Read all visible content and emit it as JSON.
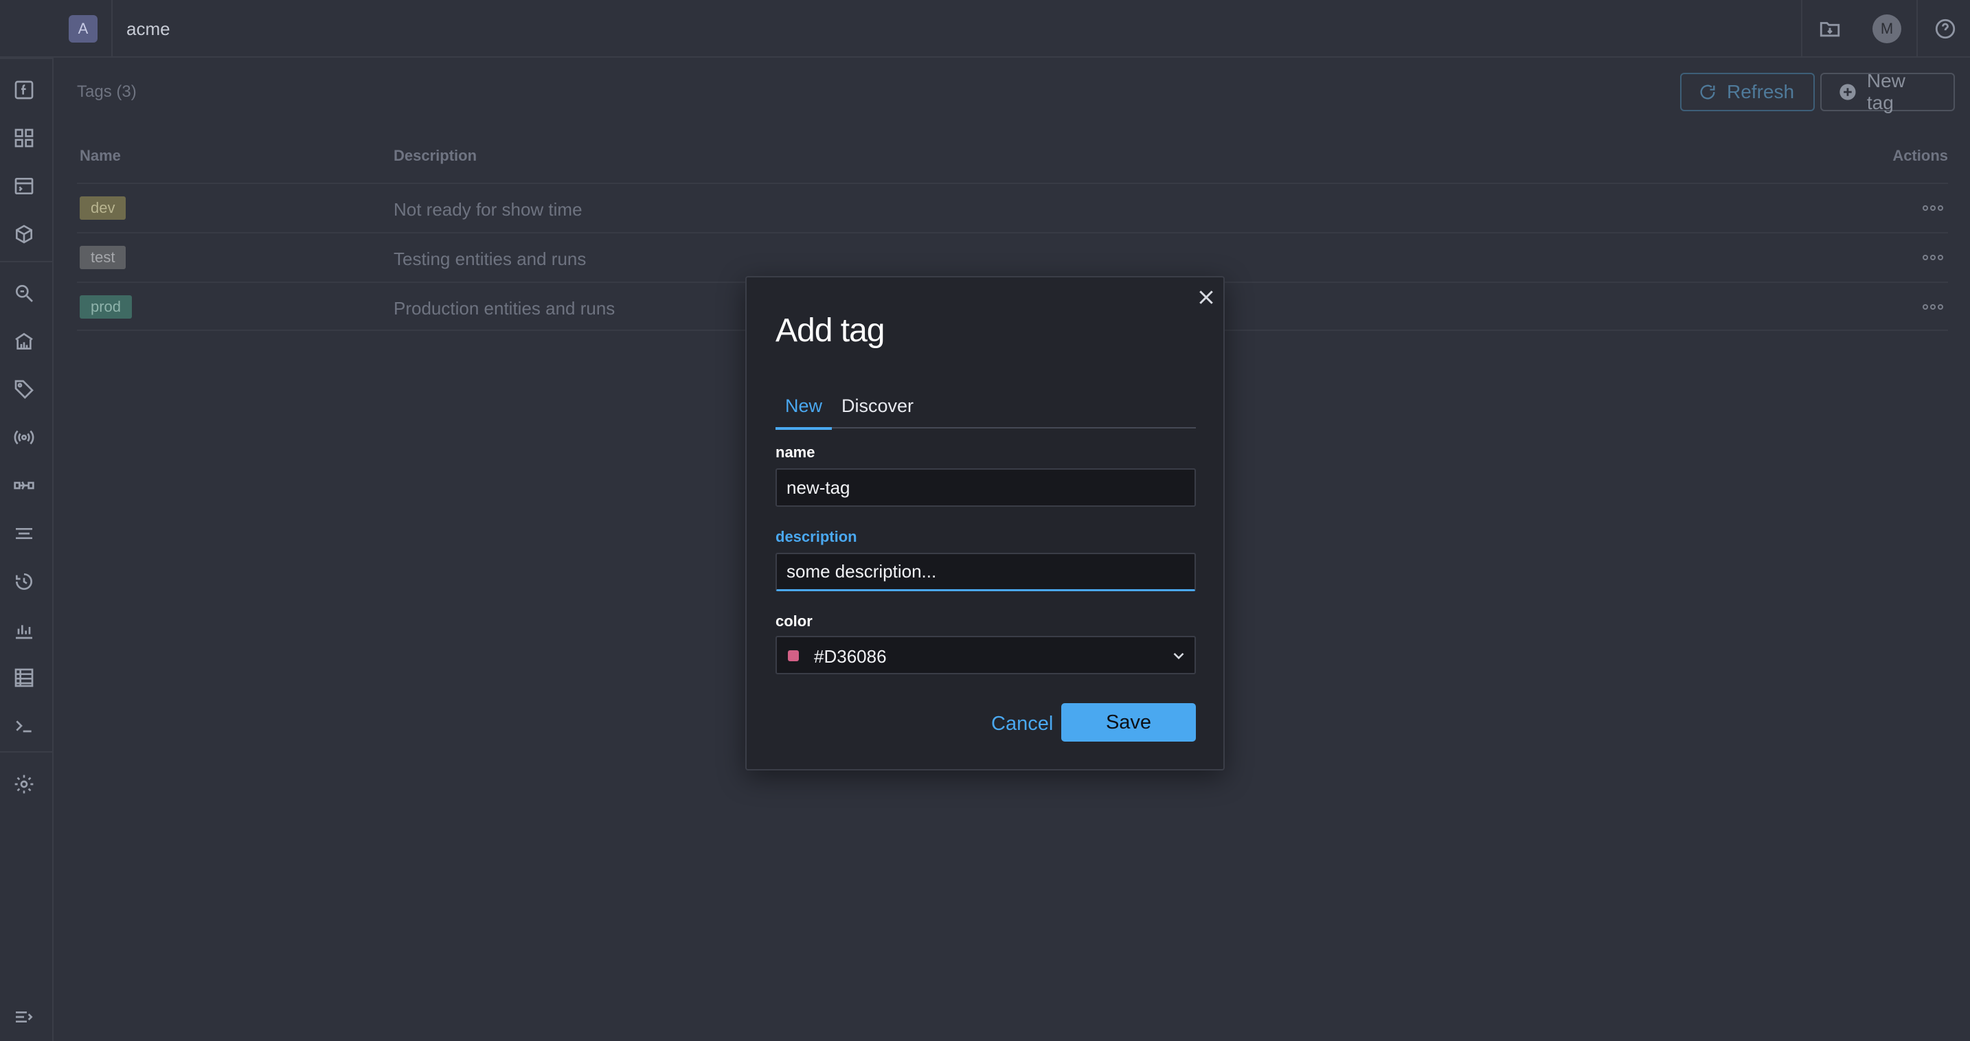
{
  "workspace": {
    "badge": "A",
    "name": "acme"
  },
  "user": {
    "avatar_initial": "M"
  },
  "sidebar": {
    "items": [
      {
        "icon": "function-icon"
      },
      {
        "icon": "dashboard-grid-icon"
      },
      {
        "icon": "terminal-window-icon"
      },
      {
        "icon": "cube-icon"
      },
      {
        "icon": "search-zoom-icon"
      },
      {
        "icon": "house-chart-icon"
      },
      {
        "icon": "tag-icon"
      },
      {
        "icon": "broadcast-icon"
      },
      {
        "icon": "pipeline-icon"
      },
      {
        "icon": "filter-lines-icon"
      },
      {
        "icon": "history-clock-icon"
      },
      {
        "icon": "bar-chart-icon"
      },
      {
        "icon": "table-icon"
      },
      {
        "icon": "console-prompt-icon"
      },
      {
        "icon": "settings-gear-icon"
      },
      {
        "icon": "collapse-menu-icon"
      }
    ]
  },
  "page": {
    "title": "Tags (3)",
    "refresh_label": "Refresh",
    "new_tag_label": "New tag"
  },
  "table": {
    "columns": [
      "Name",
      "Description",
      "Actions"
    ],
    "rows": [
      {
        "name": "dev",
        "description": "Not ready for show time",
        "chip_bg": "#6f6b4c",
        "chip_fg": "#b8b48f"
      },
      {
        "name": "test",
        "description": "Testing entities and runs",
        "chip_bg": "#5d5f63",
        "chip_fg": "#a5a7ab"
      },
      {
        "name": "prod",
        "description": "Production entities and runs",
        "chip_bg": "#3f6a63",
        "chip_fg": "#8fb3ab"
      }
    ]
  },
  "modal": {
    "title": "Add tag",
    "tabs": [
      "New",
      "Discover"
    ],
    "active_tab": "New",
    "name_label": "name",
    "name_value": "new-tag",
    "description_label": "description",
    "description_value": "some description...",
    "color_label": "color",
    "color_value": "#D36086",
    "cancel_label": "Cancel",
    "save_label": "Save"
  },
  "colors": {
    "accent": "#4aa8f0",
    "background": "#2f323c",
    "modal_bg": "#23252c",
    "selected_color": "#D36086"
  }
}
